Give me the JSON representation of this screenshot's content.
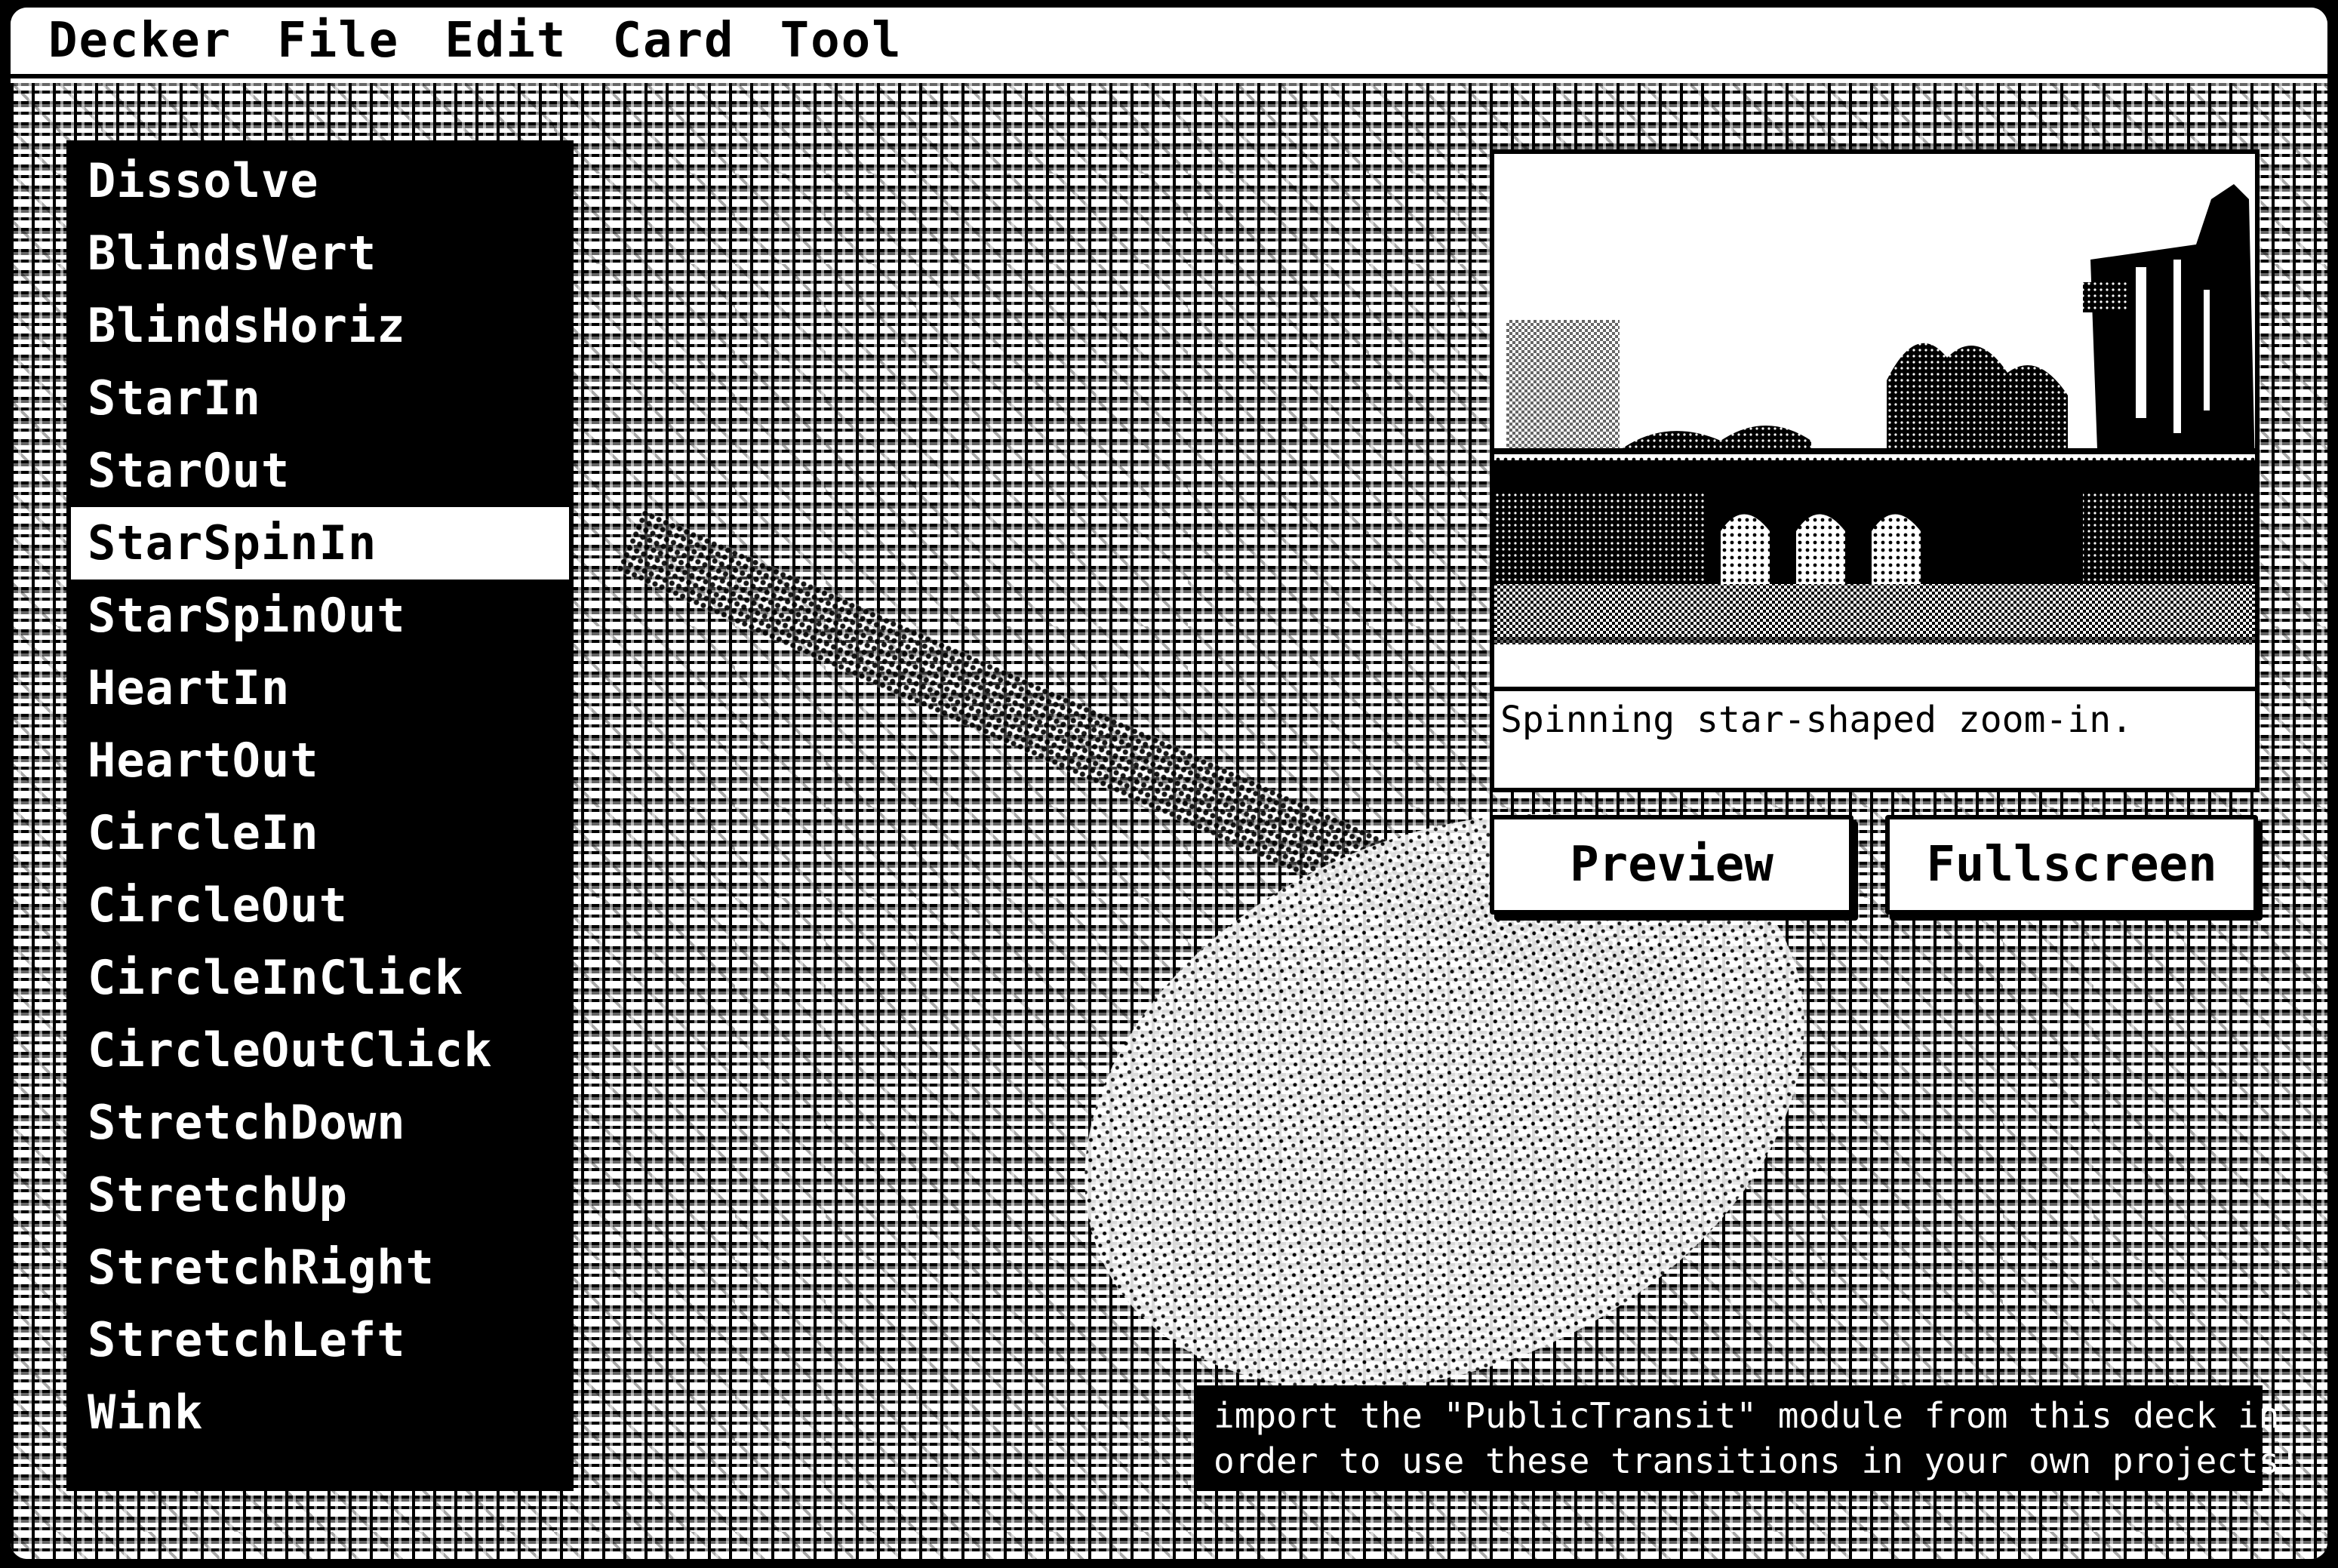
{
  "menubar": {
    "items": [
      "Decker",
      "File",
      "Edit",
      "Card",
      "Tool"
    ]
  },
  "transitions": {
    "items": [
      "Dissolve",
      "BlindsVert",
      "BlindsHoriz",
      "StarIn",
      "StarOut",
      "StarSpinIn",
      "StarSpinOut",
      "HeartIn",
      "HeartOut",
      "CircleIn",
      "CircleOut",
      "CircleInClick",
      "CircleOutClick",
      "StretchDown",
      "StretchUp",
      "StretchRight",
      "StretchLeft",
      "Wink"
    ],
    "selected": "StarSpinIn"
  },
  "description": "Spinning star-shaped zoom-in.",
  "buttons": {
    "preview_label": "Preview",
    "fullscreen_label": "Fullscreen"
  },
  "note": {
    "line1": "import the \"PublicTransit\" module from this deck in",
    "line2": "order to use these transitions in your own projects!"
  }
}
